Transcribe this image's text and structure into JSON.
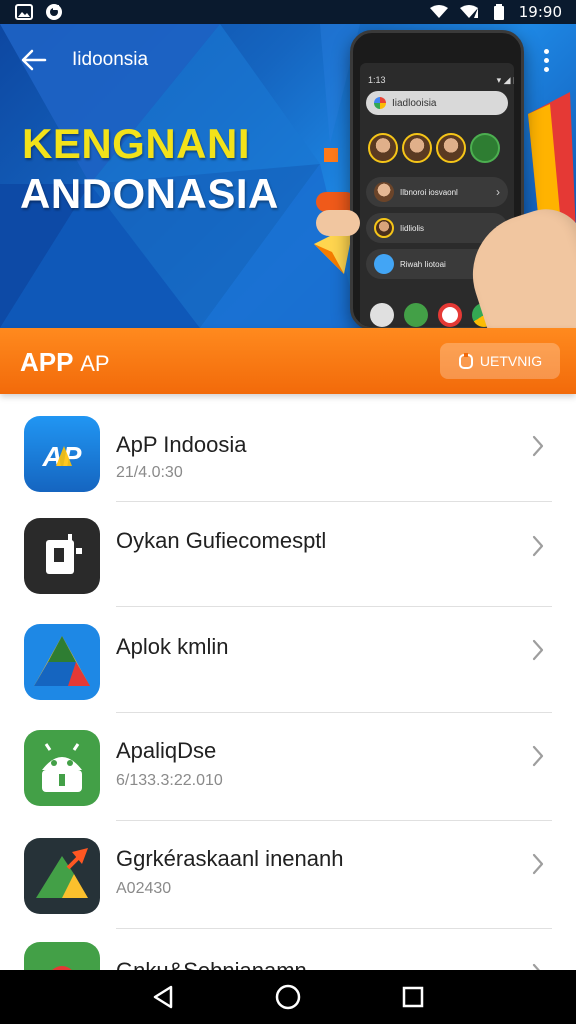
{
  "status_bar": {
    "time": "19:90",
    "left_icons": [
      "image-icon",
      "app-notification-icon"
    ],
    "right_icons": [
      "wifi-icon",
      "signal-icon",
      "battery-icon"
    ]
  },
  "hero": {
    "title": "Iidoonsia",
    "headline_line1": "KENGNANI",
    "headline_line2": "ANDONASIA",
    "phone": {
      "status_time": "1:13",
      "search_text": "Iiadlooisia",
      "rows": [
        {
          "text": "Ilbnoroi iosvaonl"
        },
        {
          "text": "Iidliolis"
        },
        {
          "text": "Riwah Iiotoai"
        }
      ]
    }
  },
  "section_bar": {
    "title_bold": "APP",
    "title_light": "AP",
    "action_label": "UETVNIG",
    "action_icon": "refresh-icon"
  },
  "apps": [
    {
      "name": "ApP Indoosia",
      "subtitle": "21/4.0:30",
      "icon": "ap-logo-icon",
      "icon_bg": "#1a73e8"
    },
    {
      "name": "Oykan Gufiecomesptl",
      "subtitle": "",
      "icon": "dark-square-app-icon",
      "icon_bg": "#2a2a2a"
    },
    {
      "name": "Aplok kmlin",
      "subtitle": "",
      "icon": "drive-triangle-icon",
      "icon_bg": "#1e88e5"
    },
    {
      "name": "ApaliqDse",
      "subtitle": "6/133.3:22.010",
      "icon": "android-bot-icon",
      "icon_bg": "#43a047"
    },
    {
      "name": "Ggrkéraskaanl inenanh",
      "subtitle": "A02430",
      "icon": "arrow-chart-icon",
      "icon_bg": "#263238"
    },
    {
      "name": "Gnku&Sebnianamn",
      "subtitle": "",
      "icon": "partial-app-icon",
      "icon_bg": "#43a047"
    }
  ],
  "colors": {
    "hero_blue": "#1565c0",
    "headline_yellow": "#f2e21a",
    "orange": "#f26a0a",
    "divider": "#e0e0e0"
  },
  "nav": {
    "back_icon": "triangle-back-icon",
    "home_icon": "circle-home-icon",
    "recents_icon": "square-recents-icon"
  }
}
